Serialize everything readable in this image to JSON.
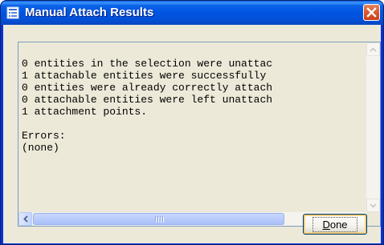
{
  "window": {
    "title": "Manual Attach Results",
    "icon": "list-window-icon"
  },
  "results": {
    "lines": [
      "0 entities in the selection were unattac",
      "1 attachable entities were successfully",
      "0 entities were already correctly attach",
      "0 attachable entities were left unattach",
      "1 attachment points.",
      "",
      "Errors:",
      "(none)"
    ]
  },
  "buttons": {
    "done_prefix": "D",
    "done_rest": "one"
  },
  "colors": {
    "titlebar": "#0054e3",
    "client": "#ece9d8",
    "close": "#dc5a2e"
  }
}
